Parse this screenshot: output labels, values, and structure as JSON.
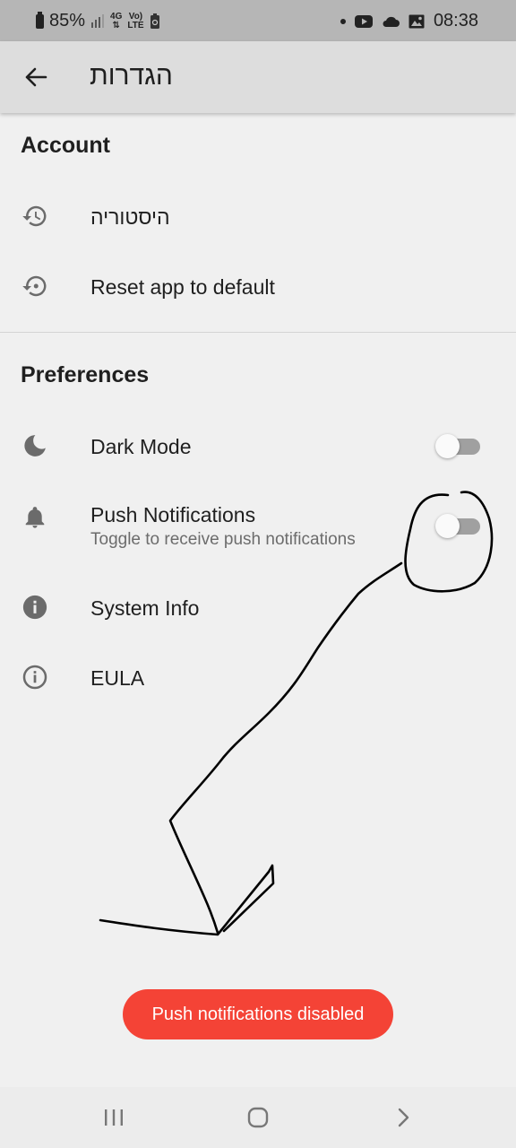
{
  "status_bar": {
    "battery": "85%",
    "network_4g": "4G",
    "volte_top": "Vo)",
    "volte_bottom": "LTE",
    "time": "08:38"
  },
  "app_bar": {
    "title": "הגדרות"
  },
  "sections": {
    "account": {
      "header": "Account",
      "items": [
        {
          "label": "היסטוריה",
          "icon": "history-icon"
        },
        {
          "label": "Reset app to default",
          "icon": "restore-icon"
        }
      ]
    },
    "preferences": {
      "header": "Preferences",
      "items": [
        {
          "label": "Dark Mode",
          "icon": "moon-icon",
          "toggle_on": false
        },
        {
          "label": "Push Notifications",
          "subtitle": "Toggle to receive push notifications",
          "icon": "bell-icon",
          "toggle_on": false
        },
        {
          "label": "System Info",
          "icon": "info-filled-icon"
        },
        {
          "label": "EULA",
          "icon": "info-outline-icon"
        }
      ]
    }
  },
  "snackbar": {
    "message": "Push notifications disabled",
    "color": "#f44336"
  },
  "colors": {
    "status_bar": "#b6b6b6",
    "app_bar": "#dddddd",
    "background": "#f0f0f0",
    "toggle_track": "#a0a0a0"
  }
}
